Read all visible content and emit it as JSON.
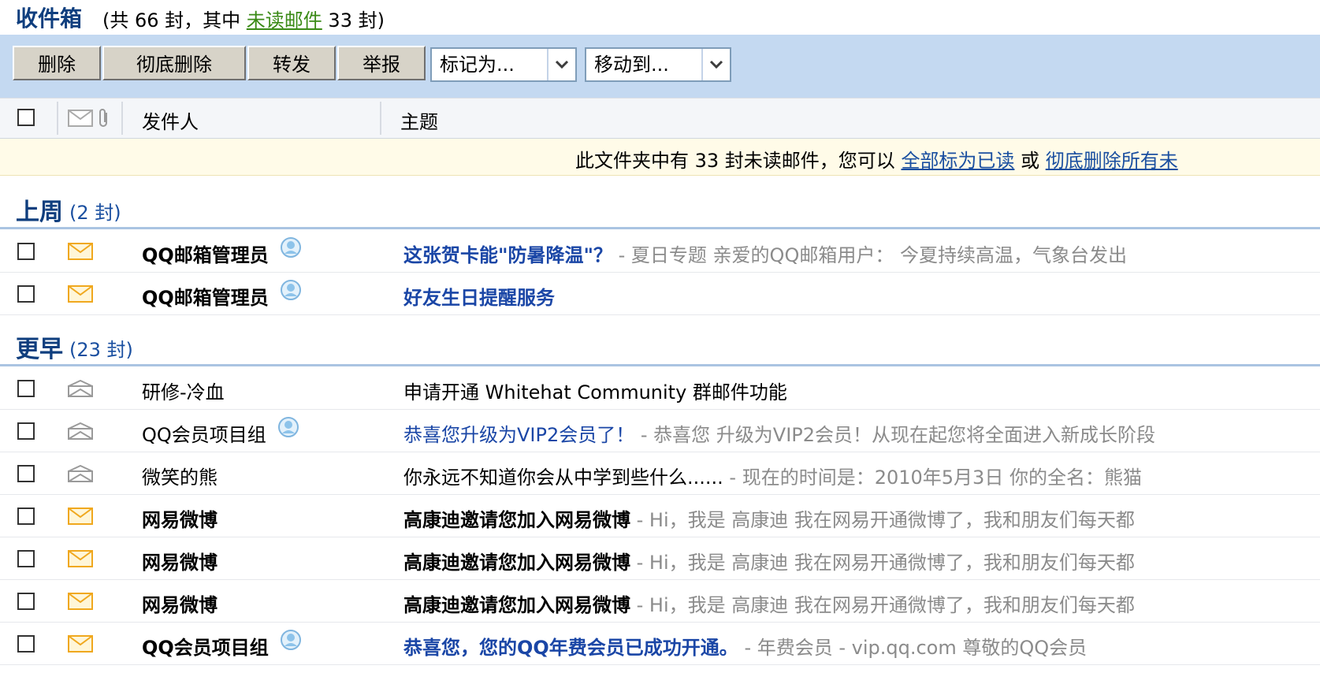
{
  "folder": {
    "title": "收件箱",
    "summary_prefix": "(共 66 封，其中 ",
    "unread_link": "未读邮件",
    "summary_suffix": " 33 封)"
  },
  "toolbar": {
    "delete": "删除",
    "delete_permanently": "彻底删除",
    "forward": "转发",
    "report": "举报",
    "mark_as": "标记为...",
    "move_to": "移动到..."
  },
  "columns": {
    "sender": "发件人",
    "subject": "主题"
  },
  "notice": {
    "text": "此文件夹中有 33 封未读邮件，您可以 ",
    "mark_all_read": "全部标为已读",
    "or": " 或 ",
    "delete_all": "彻底删除所有未"
  },
  "groups": [
    {
      "title": "上周",
      "count": "(2 封)"
    },
    {
      "title": "更早",
      "count": "(23 封)"
    }
  ],
  "rows": [
    {
      "sender": "QQ邮箱管理员",
      "subject": "这张贺卡能\"防暑降温\"？",
      "preview": " - 夏日专题 亲爱的QQ邮箱用户： 今夏持续高温，气象台发出",
      "unread": true,
      "vip": true
    },
    {
      "sender": "QQ邮箱管理员",
      "subject": "好友生日提醒服务",
      "preview": "",
      "unread": true,
      "vip": true
    },
    {
      "sender": "研修-冷血",
      "subject": "申请开通 Whitehat Community 群邮件功能",
      "preview": "",
      "unread": false,
      "vip": false
    },
    {
      "sender": "QQ会员项目组",
      "subject": "恭喜您升级为VIP2会员了！",
      "preview": " - 恭喜您 升级为VIP2会员！从现在起您将全面进入新成长阶段",
      "unread": false,
      "vip": true
    },
    {
      "sender": "微笑的熊",
      "subject": "你永远不知道你会从中学到些什么......",
      "preview": " -   现在的时间是：2010年5月3日  你的全名：熊猫",
      "unread": false,
      "vip": false
    },
    {
      "sender": "网易微博",
      "subject": "高康迪邀请您加入网易微博",
      "preview": " - Hi，我是 高康迪  我在网易开通微博了，我和朋友们每天都",
      "unread": true,
      "vip": false
    },
    {
      "sender": "网易微博",
      "subject": "高康迪邀请您加入网易微博",
      "preview": " - Hi，我是 高康迪  我在网易开通微博了，我和朋友们每天都",
      "unread": true,
      "vip": false
    },
    {
      "sender": "网易微博",
      "subject": "高康迪邀请您加入网易微博",
      "preview": " - Hi，我是 高康迪  我在网易开通微博了，我和朋友们每天都",
      "unread": true,
      "vip": false
    },
    {
      "sender": "QQ会员项目组",
      "subject": "恭喜您，您的QQ年费会员已成功开通。",
      "preview": " -   年费会员 - vip.qq.com  尊敬的QQ会员",
      "unread": true,
      "vip": true
    }
  ],
  "colors": {
    "toolbar_bg": "#c4d9f1",
    "title_blue": "#0f3e7e",
    "link_green": "#3a8a16",
    "subject_blue": "#1a46a6",
    "preview_gray": "#8b8b8b",
    "unread_envelope": "#f0a81e",
    "read_envelope": "#9a9a9a"
  },
  "icons": {
    "unread": "envelope-closed-icon",
    "read": "envelope-open-icon",
    "vip": "qq-vip-badge-icon",
    "attachment": "paperclip-icon"
  }
}
